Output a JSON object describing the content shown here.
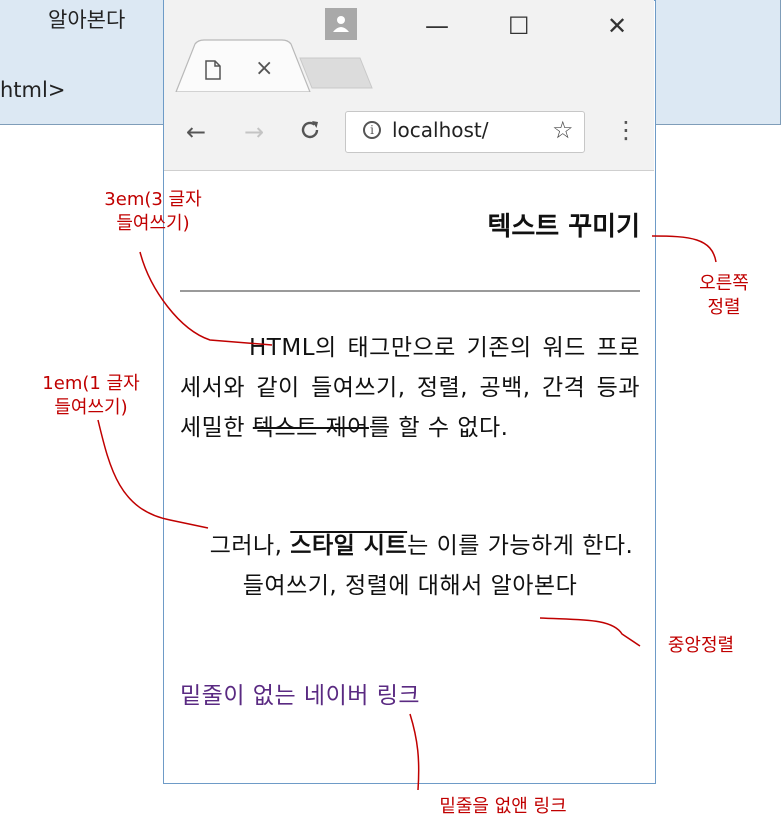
{
  "background": {
    "text_line1": "알아본다",
    "text_line2": "html>"
  },
  "browser": {
    "tab_close": "×",
    "window_minimize": "—",
    "window_maximize": "☐",
    "window_close": "✕",
    "url": "localhost/",
    "nav_back": "←",
    "nav_forward": "→",
    "nav_reload": "C",
    "star": "☆",
    "menu": "⋮",
    "info": "i"
  },
  "page": {
    "heading": "텍스트 꾸미기",
    "para1_text": "HTML의 태그만으로 기존의 워드 프로세서와 같이 들여쓰기, 정렬, 공백, 간격 등과 세밀한 ",
    "para1_strike": "텍스트 제어",
    "para1_tail": "를 할 수 없다.",
    "para2_head": "그러나, ",
    "para2_bold": "스타일 시트",
    "para2_tail": "는 이를 가능하게 한다. 들여쓰기, 정렬에 대해서 알아본다",
    "link_text": "밑줄이 없는 네이버 링크"
  },
  "annotations": {
    "indent3_line1": "3em(3 글자",
    "indent3_line2": "들여쓰기)",
    "indent1_line1": "1em(1 글자",
    "indent1_line2": "들여쓰기)",
    "right_align_line1": "오른쪽",
    "right_align_line2": "정렬",
    "center_align": "중앙정렬",
    "no_underline_link": "밑줄을 없앤 링크"
  },
  "colors": {
    "annotation": "#c00000",
    "link": "#5a2a82",
    "window_border": "#6e9bc7"
  }
}
